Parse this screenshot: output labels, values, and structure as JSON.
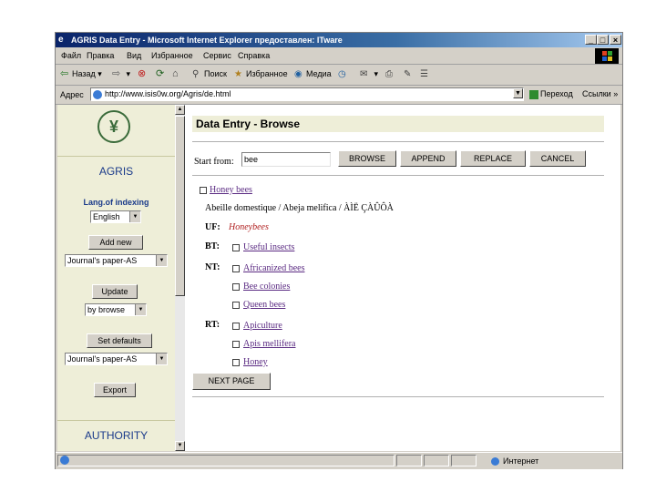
{
  "window": {
    "title": "AGRIS Data Entry - Microsoft Internet Explorer предоставлен: ITware",
    "controls": {
      "minimize": "_",
      "maximize": "□",
      "close": "×"
    }
  },
  "menu": [
    "Файл",
    "Правка",
    "Вид",
    "Избранное",
    "Сервис",
    "Справка"
  ],
  "toolbar": {
    "back": "Назад",
    "search": "Поиск",
    "favorites": "Избранное",
    "media": "Медиа"
  },
  "address": {
    "label": "Адрес",
    "url": "http://www.isis0w.org/Agris/de.html",
    "go": "Переход",
    "links": "Ссылки"
  },
  "sidebar": {
    "title": "AGRIS",
    "lang_label": "Lang.of indexing",
    "lang_value": "English",
    "add_new": "Add new",
    "journal_value": "Journal's paper-AS",
    "update": "Update",
    "browse_value": "by browse",
    "set_defaults": "Set defaults",
    "journal_value2": "Journal's paper-AS",
    "export": "Export",
    "authority": "AUTHORITY"
  },
  "main": {
    "header": "Data Entry - Browse",
    "start_label": "Start from:",
    "start_value": "bee",
    "buttons": {
      "browse": "BROWSE",
      "append": "APPEND",
      "replace": "REPLACE",
      "cancel": "CANCEL"
    },
    "term": "Honey bees",
    "translations": "Abeille domestique / Abeja melifica / ÀÌË ÇÀÛÔÀ",
    "uf_label": "UF:",
    "uf_value": "Honeybees",
    "bt_label": "BT:",
    "bt": [
      "Useful insects"
    ],
    "nt_label": "NT:",
    "nt": [
      "Africanized bees",
      "Bee colonies",
      "Queen bees"
    ],
    "rt_label": "RT:",
    "rt": [
      "Apiculture",
      "Apis mellifera",
      "Honey"
    ],
    "next_page": "NEXT PAGE"
  },
  "status": {
    "zone": "Интернет"
  }
}
